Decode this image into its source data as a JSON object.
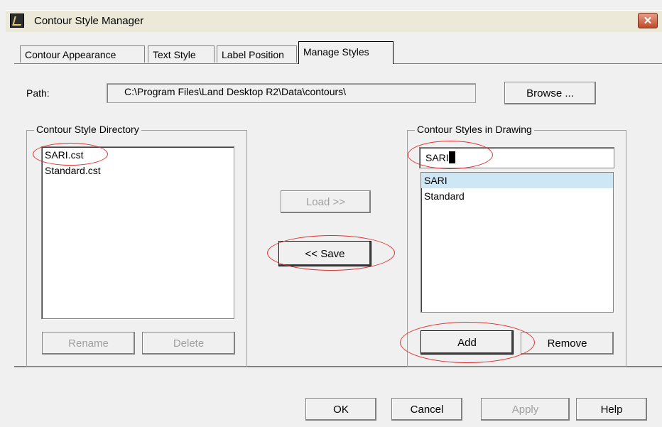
{
  "window": {
    "title": "Contour Style Manager",
    "close_glyph": "✕"
  },
  "tabs": [
    {
      "label": "Contour Appearance"
    },
    {
      "label": "Text Style"
    },
    {
      "label": "Label Position"
    },
    {
      "label": "Manage Styles"
    }
  ],
  "path": {
    "label": "Path:",
    "value": "C:\\Program Files\\Land Desktop R2\\Data\\contours\\",
    "browse_label": "Browse ..."
  },
  "directory": {
    "title": "Contour Style Directory",
    "items": [
      "SARI.cst",
      "Standard.cst"
    ],
    "rename_label": "Rename",
    "delete_label": "Delete"
  },
  "middle": {
    "load_label": "Load >>",
    "save_label": "<< Save"
  },
  "drawing": {
    "title": "Contour Styles in Drawing",
    "name_value": "SARI",
    "items": [
      "SARI",
      "Standard"
    ],
    "selected_index": 0,
    "add_label": "Add",
    "remove_label": "Remove"
  },
  "footer": {
    "ok_label": "OK",
    "cancel_label": "Cancel",
    "apply_label": "Apply",
    "help_label": "Help"
  },
  "colors": {
    "annotation_ring": "#e03030",
    "selection": "#cfe6f5"
  }
}
